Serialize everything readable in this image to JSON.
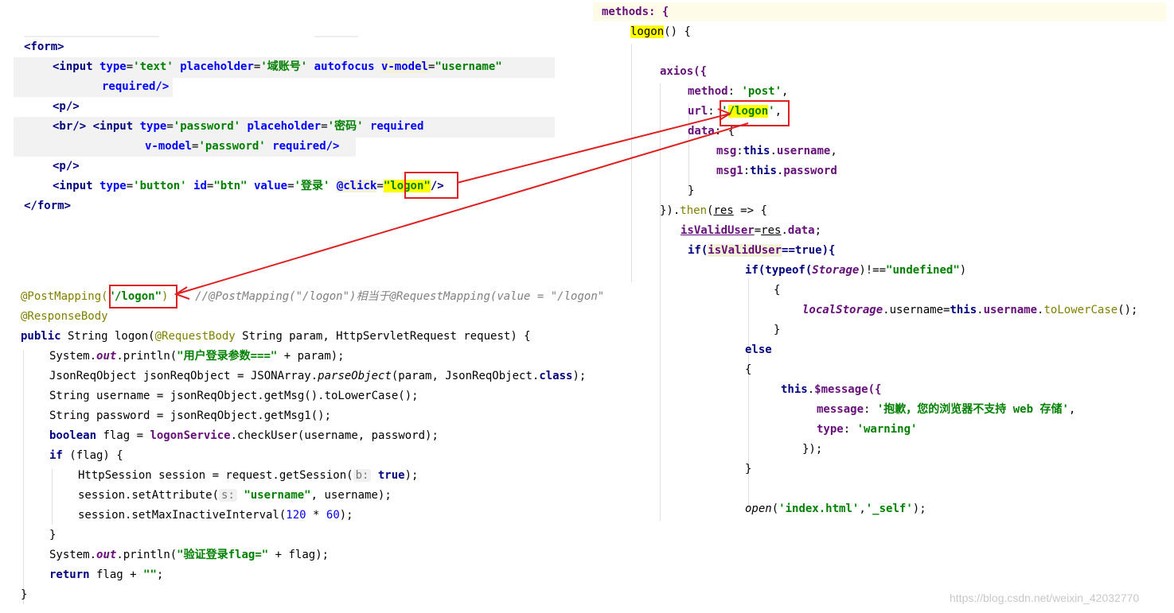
{
  "html_code": {
    "l1": "<form>",
    "l2a": "<input",
    "l2b": "type",
    "l2c": "'text'",
    "l2d": "placeholder",
    "l2e": "'域账号'",
    "l2f": "autofocus",
    "l2g": "v-model",
    "l2h": "\"username\"",
    "l3": "required/>",
    "l4": "<p/>",
    "l5a": "<br/>",
    "l5b": "<input",
    "l5c": "type",
    "l5d": "'password'",
    "l5e": "placeholder",
    "l5f": "'密码'",
    "l5g": "required",
    "l6a": "v-model",
    "l6b": "'password'",
    "l6c": "required/>",
    "l7": "<p/>",
    "l8a": "<input",
    "l8b": "type",
    "l8c": "'button'",
    "l8d": "id",
    "l8e": "\"btn\"",
    "l8f": "value",
    "l8g": "'登录'",
    "l8h": "@click",
    "l8i": "\"logon\"",
    "l8j": "/>",
    "l9": "</form>"
  },
  "js_code": {
    "l1": "methods: {",
    "l2": "logon",
    "l2b": "() {",
    "l3": "axios({",
    "l4a": "method",
    "l4b": "'post'",
    "l5a": "url",
    "l5b": "'/logon'",
    "l6a": "data",
    "l6b": "{",
    "l7a": "msg",
    "l7b": "this",
    "l7c": "username",
    "l8a": "msg1",
    "l8b": "this",
    "l8c": "password",
    "l9": "}",
    "l10a": "}).",
    "l10b": "then",
    "l10c": "res",
    "l10d": " => {",
    "l11a": "isValidUser",
    "l11b": "res",
    "l11c": "data",
    "l12a": "if(",
    "l12b": "isValidUser",
    "l12c": "==true){",
    "l13a": "if(typeof(",
    "l13b": "Storage",
    "l13c": ")!==",
    "l13d": "\"undefined\"",
    "l14": "{",
    "l15a": "localStorage",
    "l15b": ".username=",
    "l15c": "this",
    "l15d": "username",
    "l15e": "toLowerCase",
    "l16": "}",
    "l17": "else",
    "l18": "{",
    "l19a": "this",
    "l19b": "$message({",
    "l20a": "message",
    "l20b": "'抱歉，您的浏览器不支持 web 存储'",
    "l21a": "type",
    "l21b": "'warning'",
    "l22": "});",
    "l23": "}",
    "l24a": "open",
    "l24b": "'index.html'",
    "l24c": "'_self'"
  },
  "java_code": {
    "l1a": "@PostMapping(",
    "l1b": "\"/logon\"",
    "l1c": ")",
    "l1d": "//@PostMapping(\"/logon\")相当于@RequestMapping(value = \"/logon\"",
    "l2": "@ResponseBody",
    "l3a": "public",
    "l3b": " String logon(",
    "l3c": "@RequestBody",
    "l3d": " String param, HttpServletRequest request) {",
    "l4a": "System.",
    "l4b": "out",
    "l4c": ".println(",
    "l4d": "\"用户登录参数===\"",
    "l4e": " + param);",
    "l5a": "JsonReqObject jsonReqObject = JSONArray.",
    "l5b": "parseObject",
    "l5c": "(param, JsonReqObject.",
    "l5d": "class",
    "l5e": ");",
    "l6": "String username = jsonReqObject.getMsg().toLowerCase();",
    "l7": "String password = jsonReqObject.getMsg1();",
    "l8a": "boolean",
    "l8b": " flag = ",
    "l8c": "logonService",
    "l8d": ".checkUser(username, password);",
    "l9a": "if",
    "l9b": " (flag) {",
    "l10a": "HttpSession session = request.getSession(",
    "l10b": "b:",
    "l10c": "true",
    "l10d": ");",
    "l11a": "session.setAttribute(",
    "l11b": "s:",
    "l11c": "\"username\"",
    "l11d": ", username);",
    "l12a": "session.setMaxInactiveInterval(",
    "l12b": "120",
    "l12c": " * ",
    "l12d": "60",
    "l12e": ");",
    "l13": "}",
    "l14a": "System.",
    "l14b": "out",
    "l14c": ".println(",
    "l14d": "\"验证登录flag=\"",
    "l14e": " + flag);",
    "l15a": "return",
    "l15b": " flag + ",
    "l15c": "\"\"",
    "l15d": ";",
    "l16": "}"
  },
  "watermark": "https://blog.csdn.net/weixin_42032770",
  "colors": {
    "annotation_red": "#e02020",
    "highlight": "#ffff00"
  }
}
